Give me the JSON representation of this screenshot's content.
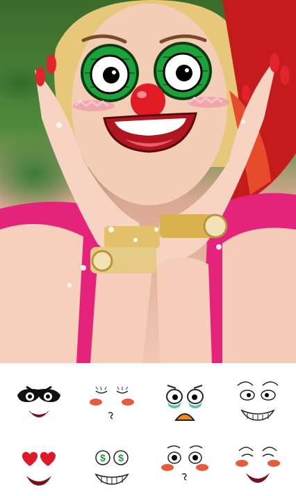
{
  "photo": {
    "description_icon": "selfie-with-clown-mask"
  },
  "effect": {
    "name": "clown-face-filter",
    "nose_color": "#e01b24",
    "eye_color": "#1aa33a"
  },
  "stickers": [
    {
      "icon": "bandit-mask-face-icon"
    },
    {
      "icon": "blushing-kiss-face-icon"
    },
    {
      "icon": "crying-face-icon"
    },
    {
      "icon": "grinning-face-icon"
    },
    {
      "icon": "heart-eyes-face-icon"
    },
    {
      "icon": "money-eyes-face-icon"
    },
    {
      "icon": "whistling-face-icon"
    },
    {
      "icon": "smiling-blush-face-icon"
    }
  ]
}
